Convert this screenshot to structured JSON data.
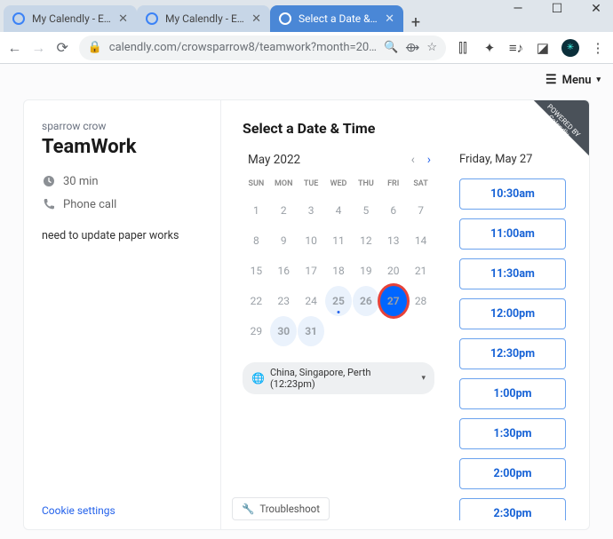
{
  "window": {
    "tabs": [
      {
        "title": "My Calendly - Edit"
      },
      {
        "title": "My Calendly - Even"
      },
      {
        "title": "Select a Date & Ti"
      }
    ],
    "url_display": "calendly.com/crowsparrow8/teamwork?month=20…"
  },
  "page": {
    "menu_label": "Menu",
    "host": "sparrow crow",
    "event_title": "TeamWork",
    "duration": "30 min",
    "location": "Phone call",
    "description": "need to update paper works",
    "cookie_link": "Cookie settings",
    "select_heading": "Select a Date & Time",
    "troubleshoot": "Troubleshoot",
    "ribbon": "POWERED BY Calendly"
  },
  "calendar": {
    "month_label": "May 2022",
    "dow": [
      "SUN",
      "MON",
      "TUE",
      "WED",
      "THU",
      "FRI",
      "SAT"
    ],
    "weeks": [
      [
        {
          "n": "1"
        },
        {
          "n": "2"
        },
        {
          "n": "3"
        },
        {
          "n": "4"
        },
        {
          "n": "5"
        },
        {
          "n": "6"
        },
        {
          "n": "7"
        }
      ],
      [
        {
          "n": "8"
        },
        {
          "n": "9"
        },
        {
          "n": "10"
        },
        {
          "n": "11"
        },
        {
          "n": "12"
        },
        {
          "n": "13"
        },
        {
          "n": "14"
        }
      ],
      [
        {
          "n": "15"
        },
        {
          "n": "16"
        },
        {
          "n": "17"
        },
        {
          "n": "18"
        },
        {
          "n": "19"
        },
        {
          "n": "20"
        },
        {
          "n": "21"
        }
      ],
      [
        {
          "n": "22"
        },
        {
          "n": "23"
        },
        {
          "n": "24"
        },
        {
          "n": "25",
          "avail": true,
          "today": true
        },
        {
          "n": "26",
          "avail": true
        },
        {
          "n": "27",
          "selected": true
        },
        {
          "n": "28"
        }
      ],
      [
        {
          "n": "29"
        },
        {
          "n": "30",
          "avail": true
        },
        {
          "n": "31",
          "avail": true
        },
        {
          "n": ""
        },
        {
          "n": ""
        },
        {
          "n": ""
        },
        {
          "n": ""
        }
      ]
    ],
    "timezone": "China, Singapore, Perth (12:23pm)"
  },
  "slots": {
    "date_label": "Friday, May 27",
    "times": [
      "10:30am",
      "11:00am",
      "11:30am",
      "12:00pm",
      "12:30pm",
      "1:00pm",
      "1:30pm",
      "2:00pm",
      "2:30pm"
    ]
  }
}
